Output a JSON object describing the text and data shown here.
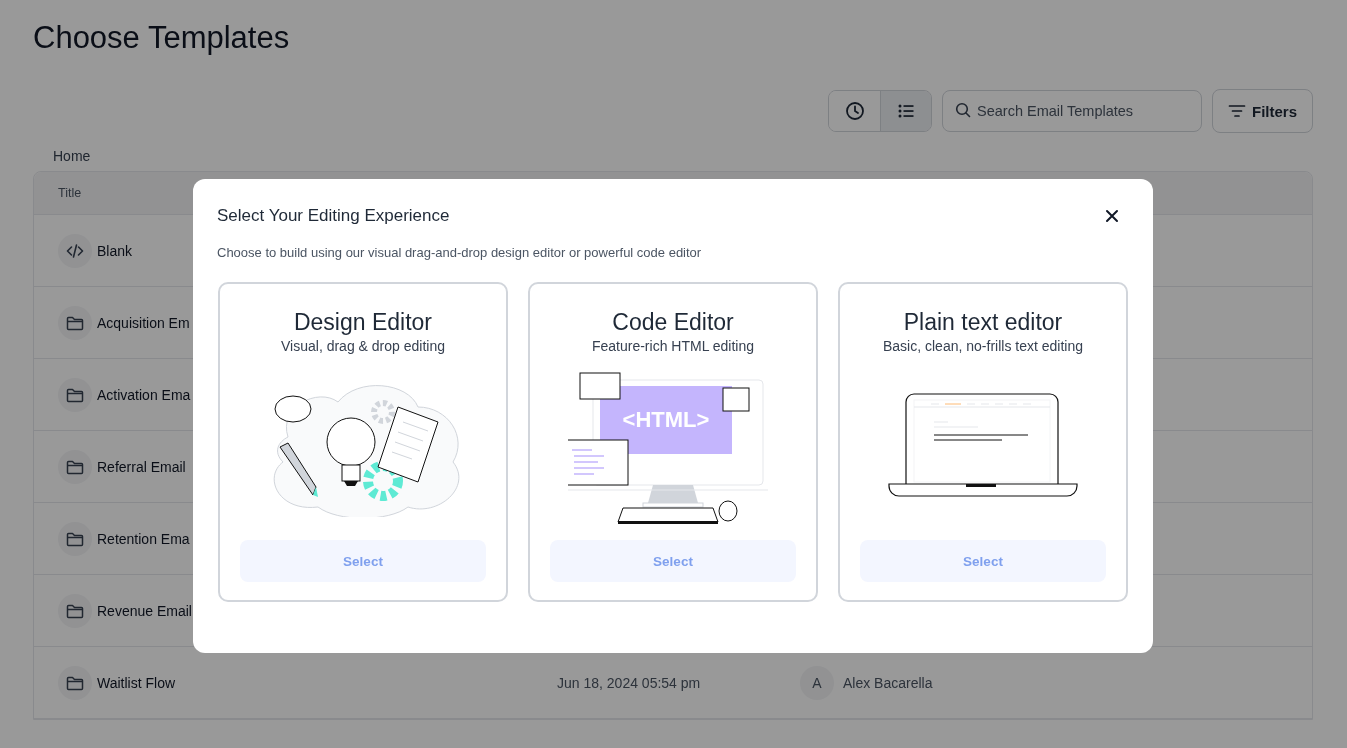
{
  "page": {
    "title": "Choose Templates"
  },
  "toolbar": {
    "view_buttons": [
      {
        "kind": "recent",
        "selected": false
      },
      {
        "kind": "list",
        "selected": true
      }
    ],
    "search": {
      "placeholder": "Search Email Templates"
    },
    "filters_label": "Filters"
  },
  "breadcrumb": "Home",
  "table": {
    "columns": [
      "Title"
    ],
    "rows": [
      {
        "kind": "code",
        "title": "Blank"
      },
      {
        "kind": "folder",
        "title": "Acquisition Em"
      },
      {
        "kind": "folder",
        "title": "Activation Ema"
      },
      {
        "kind": "folder",
        "title": "Referral Email"
      },
      {
        "kind": "folder",
        "title": "Retention Ema"
      },
      {
        "kind": "folder",
        "title": "Revenue Email"
      },
      {
        "kind": "folder",
        "title": "Waitlist Flow",
        "date": "Jun 18, 2024 05:54 pm",
        "avatar": "A",
        "author": "Alex Bacarella"
      }
    ]
  },
  "modal": {
    "title": "Select Your Editing Experience",
    "subtitle": "Choose to build using our visual drag-and-drop design editor or powerful code editor",
    "options": [
      {
        "kind": "design",
        "title": "Design Editor",
        "description": "Visual, drag & drop editing",
        "button": "Select"
      },
      {
        "kind": "code",
        "title": "Code Editor",
        "description": "Feature-rich HTML editing",
        "button": "Select",
        "screen_text": "<HTML>"
      },
      {
        "kind": "plain",
        "title": "Plain text editor",
        "description": "Basic, clean, no-frills text editing",
        "button": "Select"
      }
    ]
  }
}
